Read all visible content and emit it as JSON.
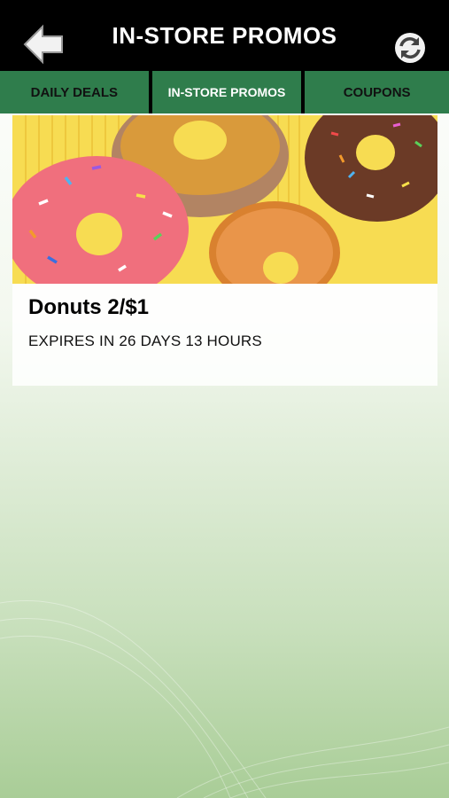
{
  "header": {
    "title": "IN-STORE PROMOS",
    "back_icon": "back-arrow-icon",
    "refresh_icon": "refresh-icon"
  },
  "tabs": [
    {
      "label": "DAILY DEALS",
      "active": false
    },
    {
      "label": "IN-STORE PROMOS",
      "active": true
    },
    {
      "label": "COUPONS",
      "active": false
    }
  ],
  "promos": [
    {
      "title": "Donuts 2/$1",
      "expiry": "EXPIRES IN 26 DAYS 13 HOURS",
      "image": "donuts-photo"
    }
  ],
  "colors": {
    "header_bg": "#000000",
    "tab_bg": "#2f7d4c",
    "banner_yellow": "#f7dc52"
  }
}
